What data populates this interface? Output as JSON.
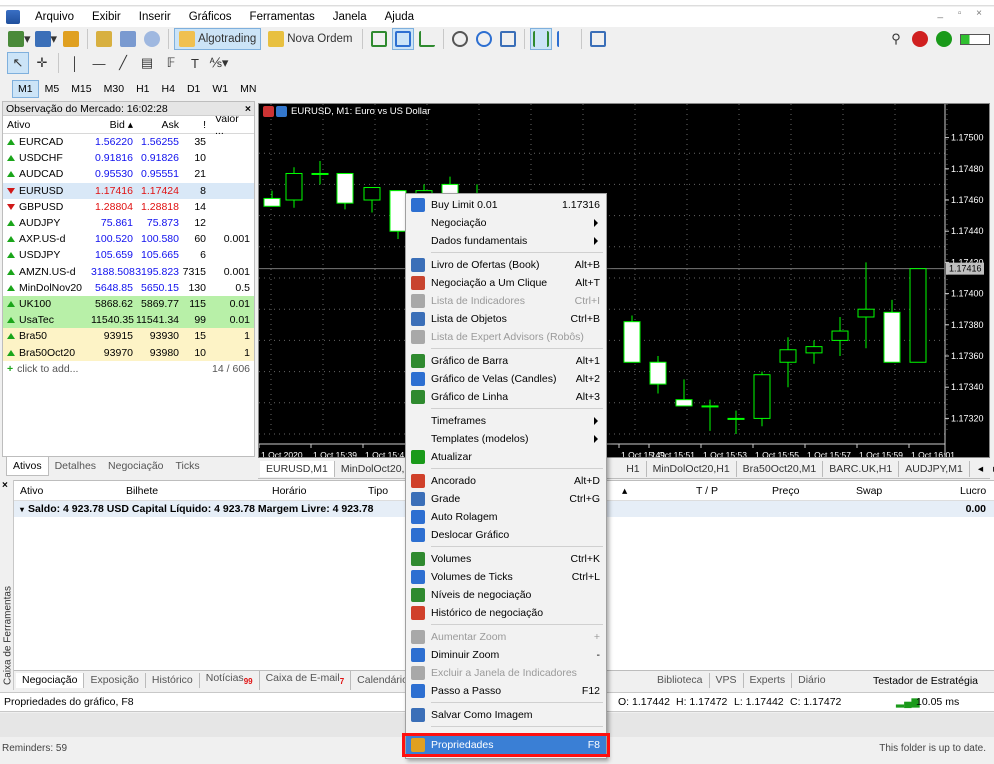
{
  "menu": {
    "items": [
      "Arquivo",
      "Exibir",
      "Inserir",
      "Gráficos",
      "Ferramentas",
      "Janela",
      "Ajuda"
    ]
  },
  "toolbar": {
    "algotrading_label": "Algotrading",
    "nova_ordem_label": "Nova Ordem"
  },
  "timeframes": [
    "M1",
    "M5",
    "M15",
    "M30",
    "H1",
    "H4",
    "D1",
    "W1",
    "MN"
  ],
  "timeframe_selected": "M1",
  "market_watch": {
    "title": "Observação do Mercado: 16:02:28",
    "columns": [
      "Ativo",
      "Bid",
      "Ask",
      "!",
      "Valor ..."
    ],
    "rows": [
      {
        "symbol": "EURCAD",
        "bid": "1.56220",
        "ask": "1.56255",
        "spread": "35",
        "value": "",
        "dir": "up",
        "hl": ""
      },
      {
        "symbol": "USDCHF",
        "bid": "0.91816",
        "ask": "0.91826",
        "spread": "10",
        "value": "",
        "dir": "up",
        "hl": ""
      },
      {
        "symbol": "AUDCAD",
        "bid": "0.95530",
        "ask": "0.95551",
        "spread": "21",
        "value": "",
        "dir": "up",
        "hl": ""
      },
      {
        "symbol": "EURUSD",
        "bid": "1.17416",
        "ask": "1.17424",
        "spread": "8",
        "value": "",
        "dir": "dn",
        "hl": "sel"
      },
      {
        "symbol": "GBPUSD",
        "bid": "1.28804",
        "ask": "1.28818",
        "spread": "14",
        "value": "",
        "dir": "dn",
        "hl": ""
      },
      {
        "symbol": "AUDJPY",
        "bid": "75.861",
        "ask": "75.873",
        "spread": "12",
        "value": "",
        "dir": "up",
        "hl": ""
      },
      {
        "symbol": "AXP.US-d",
        "bid": "100.520",
        "ask": "100.580",
        "spread": "60",
        "value": "0.001",
        "dir": "up",
        "hl": ""
      },
      {
        "symbol": "USDJPY",
        "bid": "105.659",
        "ask": "105.665",
        "spread": "6",
        "value": "",
        "dir": "up",
        "hl": ""
      },
      {
        "symbol": "AMZN.US-d",
        "bid": "3188.508",
        "ask": "3195.823",
        "spread": "7315",
        "value": "0.001",
        "dir": "up",
        "hl": ""
      },
      {
        "symbol": "MinDolNov20",
        "bid": "5648.85",
        "ask": "5650.15",
        "spread": "130",
        "value": "0.5",
        "dir": "up",
        "hl": ""
      },
      {
        "symbol": "UK100",
        "bid": "5868.62",
        "ask": "5869.77",
        "spread": "115",
        "value": "0.01",
        "dir": "up",
        "hl": "green"
      },
      {
        "symbol": "UsaTec",
        "bid": "11540.35",
        "ask": "11541.34",
        "spread": "99",
        "value": "0.01",
        "dir": "up",
        "hl": "green"
      },
      {
        "symbol": "Bra50",
        "bid": "93915",
        "ask": "93930",
        "spread": "15",
        "value": "1",
        "dir": "up",
        "hl": "yel"
      },
      {
        "symbol": "Bra50Oct20",
        "bid": "93970",
        "ask": "93980",
        "spread": "10",
        "value": "1",
        "dir": "up",
        "hl": "yel"
      }
    ],
    "add_label": "click to add...",
    "count": "14 / 606",
    "tabs": [
      "Ativos",
      "Detalhes",
      "Negociação",
      "Ticks"
    ]
  },
  "chart": {
    "title": "EURUSD, M1:  Euro vs US Dollar",
    "price_labels": [
      "1.17500",
      "1.17480",
      "1.17460",
      "1.17440",
      "1.17420",
      "1.17400",
      "1.17380",
      "1.17360",
      "1.17340",
      "1.17320"
    ],
    "current_price": "1.17416",
    "time_labels": [
      "1 Oct 2020",
      "1 Oct 15:39",
      "1 Oct 15:41",
      "1 Oct 15:49",
      "1 Oct 15:51",
      "1 Oct 15:53",
      "1 Oct 15:55",
      "1 Oct 15:57",
      "1 Oct 15:59",
      "1 Oct 16:01"
    ],
    "tabs": [
      "EURUSD,M1",
      "MinDolOct20,M",
      "H1",
      "MinDolOct20,H1",
      "Bra50Oct20,M1",
      "BARC.UK,H1",
      "AUDJPY,M1"
    ]
  },
  "chart_data": {
    "type": "candlestick",
    "symbol": "EURUSD",
    "timeframe": "M1",
    "ylim": [
      1.1731,
      1.1751
    ],
    "candles": [
      {
        "o": 1.17461,
        "h": 1.17466,
        "l": 1.17456,
        "c": 1.17456
      },
      {
        "o": 1.1746,
        "h": 1.17481,
        "l": 1.17455,
        "c": 1.17477
      },
      {
        "o": 1.17477,
        "h": 1.17485,
        "l": 1.1747,
        "c": 1.17477
      },
      {
        "o": 1.17477,
        "h": 1.17477,
        "l": 1.17454,
        "c": 1.17458
      },
      {
        "o": 1.1746,
        "h": 1.17468,
        "l": 1.17452,
        "c": 1.17468
      },
      {
        "o": 1.17466,
        "h": 1.17466,
        "l": 1.17435,
        "c": 1.1744
      },
      {
        "o": 1.1744,
        "h": 1.1747,
        "l": 1.17425,
        "c": 1.17466
      },
      {
        "o": 1.1747,
        "h": 1.17475,
        "l": 1.1746,
        "c": 1.17462
      },
      {
        "o": 1.17462,
        "h": 1.1747,
        "l": 1.1744,
        "c": 1.17445
      },
      {
        "o": 1.17382,
        "h": 1.17386,
        "l": 1.17356,
        "c": 1.17356
      },
      {
        "o": 1.17356,
        "h": 1.1736,
        "l": 1.17336,
        "c": 1.17342
      },
      {
        "o": 1.17332,
        "h": 1.17345,
        "l": 1.17328,
        "c": 1.17328
      },
      {
        "o": 1.17328,
        "h": 1.17332,
        "l": 1.17312,
        "c": 1.17328
      },
      {
        "o": 1.1732,
        "h": 1.17325,
        "l": 1.1731,
        "c": 1.1732
      },
      {
        "o": 1.1732,
        "h": 1.1735,
        "l": 1.17315,
        "c": 1.17348
      },
      {
        "o": 1.17356,
        "h": 1.17372,
        "l": 1.1734,
        "c": 1.17364
      },
      {
        "o": 1.17362,
        "h": 1.1737,
        "l": 1.17355,
        "c": 1.17366
      },
      {
        "o": 1.1737,
        "h": 1.17385,
        "l": 1.1736,
        "c": 1.17376
      },
      {
        "o": 1.17385,
        "h": 1.1742,
        "l": 1.17365,
        "c": 1.1739
      },
      {
        "o": 1.17388,
        "h": 1.17396,
        "l": 1.17356,
        "c": 1.17356
      },
      {
        "o": 1.17356,
        "h": 1.17416,
        "l": 1.17356,
        "c": 1.17416
      }
    ]
  },
  "context_menu": {
    "items": [
      {
        "label": "Buy Limit 0.01",
        "shortcut": "1.17316",
        "icon": "buy-limit-icon",
        "color": "#2d6fd1"
      },
      {
        "label": "Negociação",
        "submenu": true
      },
      {
        "label": "Dados fundamentais",
        "submenu": true
      },
      {
        "sep": true
      },
      {
        "label": "Livro de Ofertas (Book)",
        "shortcut": "Alt+B",
        "icon": "book-icon",
        "color": "#3b6fb8"
      },
      {
        "label": "Negociação a Um Clique",
        "shortcut": "Alt+T",
        "icon": "one-click-icon",
        "color": "#c8442f"
      },
      {
        "label": "Lista de Indicadores",
        "shortcut": "Ctrl+I",
        "icon": "indicators-icon",
        "color": "#a8a8a8",
        "disabled": true
      },
      {
        "label": "Lista de Objetos",
        "shortcut": "Ctrl+B",
        "icon": "objects-icon",
        "color": "#3b6fb8"
      },
      {
        "label": "Lista de Expert Advisors (Robôs)",
        "icon": "experts-icon",
        "color": "#a8a8a8",
        "disabled": true
      },
      {
        "sep": true
      },
      {
        "label": "Gráfico de Barra",
        "shortcut": "Alt+1",
        "icon": "bar-chart-icon",
        "color": "#2f8a2f"
      },
      {
        "label": "Gráfico de Velas (Candles)",
        "shortcut": "Alt+2",
        "icon": "candles-icon",
        "color": "#2d6fd1"
      },
      {
        "label": "Gráfico de Linha",
        "shortcut": "Alt+3",
        "icon": "line-chart-icon",
        "color": "#2f8a2f"
      },
      {
        "sep": true
      },
      {
        "label": "Timeframes",
        "submenu": true
      },
      {
        "label": "Templates (modelos)",
        "submenu": true
      },
      {
        "label": "Atualizar",
        "icon": "refresh-icon",
        "color": "#1a9a1a"
      },
      {
        "sep": true
      },
      {
        "label": "Ancorado",
        "shortcut": "Alt+D",
        "icon": "pin-icon",
        "color": "#d0402a"
      },
      {
        "label": "Grade",
        "shortcut": "Ctrl+G",
        "icon": "grid-icon",
        "color": "#3b6fb8"
      },
      {
        "label": "Auto Rolagem",
        "icon": "autoscroll-icon",
        "color": "#2d6fd1"
      },
      {
        "label": "Deslocar Gráfico",
        "icon": "shift-chart-icon",
        "color": "#2d6fd1"
      },
      {
        "sep": true
      },
      {
        "label": "Volumes",
        "shortcut": "Ctrl+K",
        "icon": "volumes-icon",
        "color": "#2f8a2f"
      },
      {
        "label": "Volumes de Ticks",
        "shortcut": "Ctrl+L",
        "icon": "tick-volumes-icon",
        "color": "#2d6fd1"
      },
      {
        "label": "Níveis de negociação",
        "icon": "trade-levels-icon",
        "color": "#2f8a2f"
      },
      {
        "label": "Histórico de negociação",
        "icon": "trade-history-icon",
        "color": "#d0402a"
      },
      {
        "sep": true
      },
      {
        "label": "Aumentar Zoom",
        "shortcut": "+",
        "icon": "zoom-in-icon",
        "color": "#a8a8a8",
        "disabled": true
      },
      {
        "label": "Diminuir Zoom",
        "shortcut": "-",
        "icon": "zoom-out-icon",
        "color": "#2d6fd1"
      },
      {
        "label": "Excluir a Janela de Indicadores",
        "icon": "delete-window-icon",
        "color": "#a8a8a8",
        "disabled": true
      },
      {
        "label": "Passo a Passo",
        "shortcut": "F12",
        "icon": "step-icon",
        "color": "#2d6fd1"
      },
      {
        "sep": true
      },
      {
        "label": "Salvar Como Imagem",
        "icon": "save-image-icon",
        "color": "#3b6fb8"
      },
      {
        "sep": true
      },
      {
        "label": "Propriedades",
        "shortcut": "F8",
        "icon": "properties-icon",
        "color": "#e0a020",
        "selected": true
      }
    ]
  },
  "toolbox": {
    "side_label": "Caixa de Ferramentas",
    "columns": [
      "Ativo",
      "Bilhete",
      "Horário",
      "Tipo",
      "T / P",
      "Preço",
      "Swap",
      "Lucro"
    ],
    "balance": "Saldo: 4 923.78 USD  Capital Líquido: 4 923.78  Margem Livre: 4 923.78",
    "profit": "0.00",
    "tabs": [
      "Negociação",
      "Exposição",
      "Histórico",
      "Notícias",
      "Caixa de E-mail",
      "Calendário",
      "Biblioteca",
      "VPS",
      "Experts",
      "Diário"
    ],
    "news_badge": "99",
    "mail_badge": "7",
    "strategy_tester": "Testador de Estratégia"
  },
  "statusbar": {
    "left": "Propriedades do gráfico, F8",
    "ohlc": [
      "O: 1.17442",
      "H: 1.17472",
      "L: 1.17442",
      "C: 1.17472"
    ],
    "traffic": "10.05 ms",
    "reminders": "Reminders: 59",
    "folder_note": "This folder is up to date."
  }
}
